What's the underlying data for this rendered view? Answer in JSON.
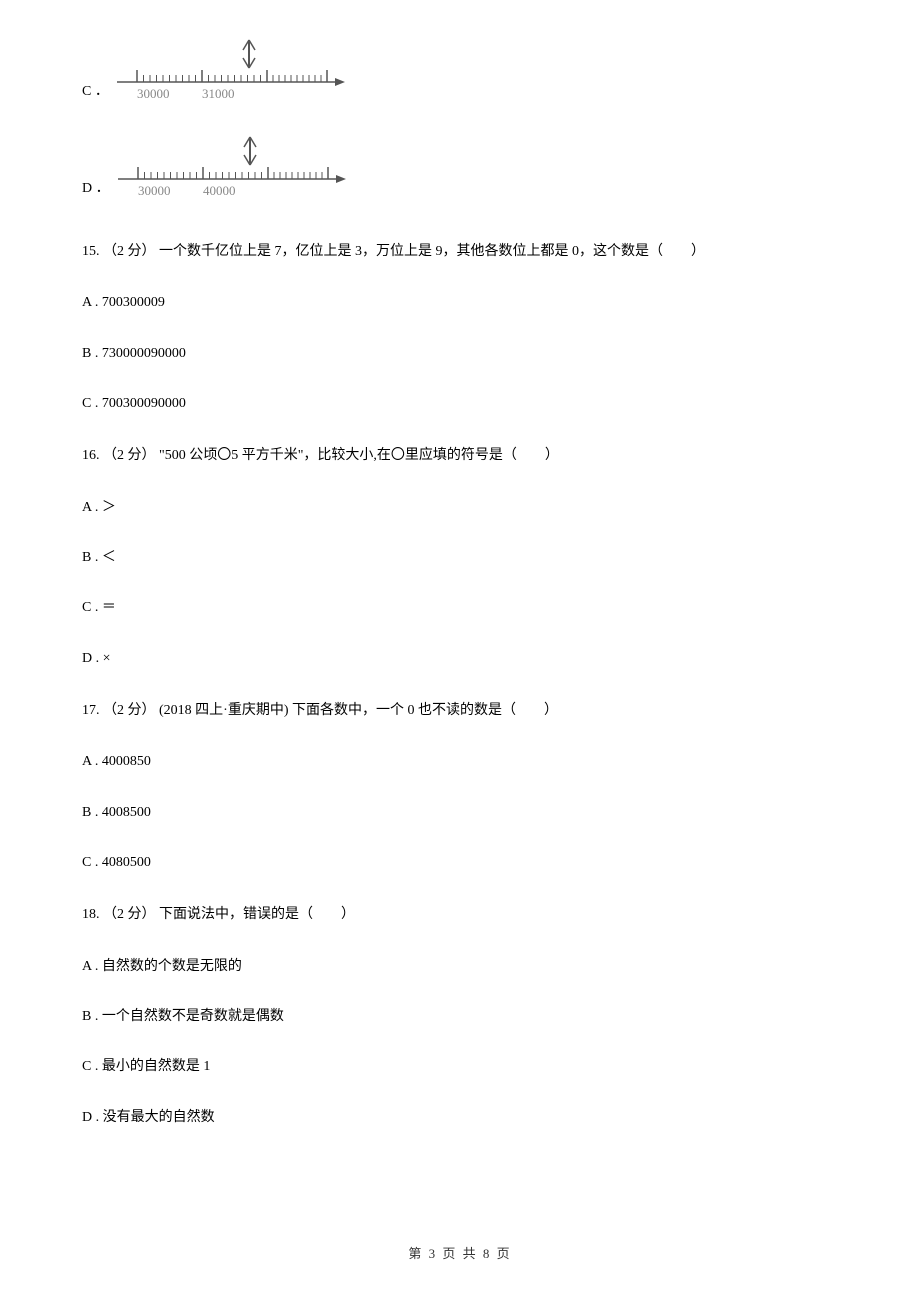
{
  "nlC": {
    "label": "C ．",
    "left": "30000",
    "right": "31000"
  },
  "nlD": {
    "label": "D ．",
    "left": "30000",
    "right": "40000"
  },
  "q15": {
    "stem": "15. （2 分） 一个数千亿位上是 7，亿位上是 3，万位上是 9，其他各数位上都是 0，这个数是（　　）",
    "a": "A . 700300009",
    "b": "B . 730000090000",
    "c": "C . 700300090000"
  },
  "q16": {
    "stem": "16. （2 分） \"500 公顷〇5 平方千米\"，比较大小,在〇里应填的符号是（　　）",
    "a": "A . ＞",
    "b": "B . ＜",
    "c": "C . ＝",
    "d": "D . ×"
  },
  "q17": {
    "stem": "17. （2 分） (2018 四上·重庆期中) 下面各数中，一个 0 也不读的数是（　　）",
    "a": "A . 4000850",
    "b": "B . 4008500",
    "c": "C . 4080500"
  },
  "q18": {
    "stem": "18. （2 分） 下面说法中，错误的是（　　）",
    "a": "A . 自然数的个数是无限的",
    "b": "B . 一个自然数不是奇数就是偶数",
    "c": "C . 最小的自然数是 1",
    "d": "D . 没有最大的自然数"
  },
  "footer": "第 3 页 共 8 页"
}
